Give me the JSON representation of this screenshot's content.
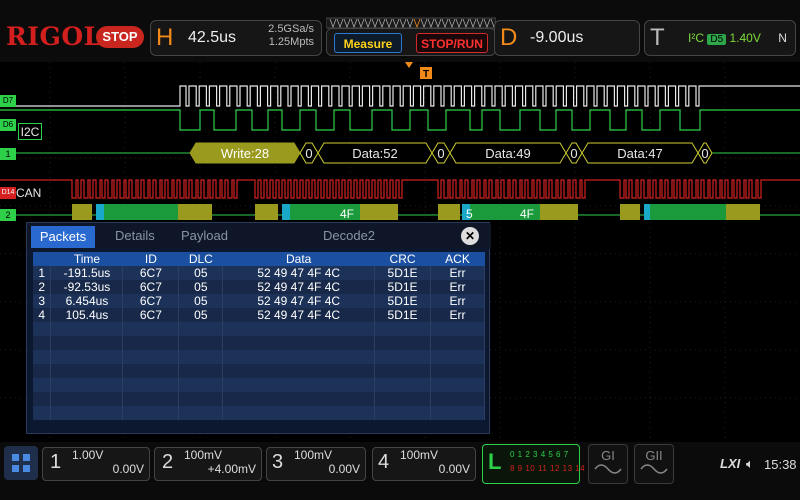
{
  "topbar": {
    "logo": "RIGOL",
    "run_state": "STOP",
    "horizontal": {
      "letter": "H",
      "timebase": "42.5us",
      "sample_rate": "2.5GSa/s",
      "memory": "1.25Mpts"
    },
    "measure_label": "Measure",
    "stoprun_label": "STOP/RUN",
    "delay": {
      "letter": "D",
      "value": "-9.00us"
    },
    "trigger": {
      "letter": "T",
      "type": "I²C",
      "source": "D5",
      "level": "1.40V",
      "mode": "N"
    }
  },
  "channels": {
    "d7": "D7",
    "d6": "D6",
    "d15_14": "D15",
    "d14": "D14",
    "i2c_label": "I2C",
    "can_label": "CAN",
    "bus1": "1",
    "bus2": "2"
  },
  "i2c_decode": [
    "Write:28",
    "0",
    "Data:52",
    "0",
    "Data:49",
    "0",
    "Data:47",
    "0"
  ],
  "can_decode": [
    "4F",
    "5",
    "4F"
  ],
  "panel": {
    "tabs": [
      "Packets",
      "Details",
      "Payload",
      "Decode2"
    ],
    "headers": [
      "",
      "Time",
      "ID",
      "DLC",
      "Data",
      "CRC",
      "ACK"
    ],
    "rows": [
      [
        "1",
        "-191.5us",
        "6C7",
        "05",
        "52 49 47 4F 4C",
        "5D1E",
        "Err"
      ],
      [
        "2",
        "-92.53us",
        "6C7",
        "05",
        "52 49 47 4F 4C",
        "5D1E",
        "Err"
      ],
      [
        "3",
        "6.454us",
        "6C7",
        "05",
        "52 49 47 4F 4C",
        "5D1E",
        "Err"
      ],
      [
        "4",
        "105.4us",
        "6C7",
        "05",
        "52 49 47 4F 4C",
        "5D1E",
        "Err"
      ]
    ]
  },
  "bottombar": {
    "ch1": {
      "num": "1",
      "scale": "1.00V",
      "offset": "0.00V"
    },
    "ch2": {
      "num": "2",
      "scale": "100mV",
      "offset": "+4.00mV"
    },
    "ch3": {
      "num": "3",
      "scale": "100mV",
      "offset": "0.00V"
    },
    "ch4": {
      "num": "4",
      "scale": "100mV",
      "offset": "0.00V"
    },
    "la": {
      "letter": "L",
      "row1": "0 1 2 3  4 5 6 7",
      "row2": "8 9 10 11 12 13 14 15"
    },
    "g1": "GI",
    "g2": "GII",
    "lxi": "LXI",
    "clock": "15:38"
  },
  "colors": {
    "orange": "#f28a1a",
    "green": "#2ed04a",
    "red": "#d41f1f",
    "olive": "#9a9a1e",
    "blue": "#2a6ad0"
  }
}
